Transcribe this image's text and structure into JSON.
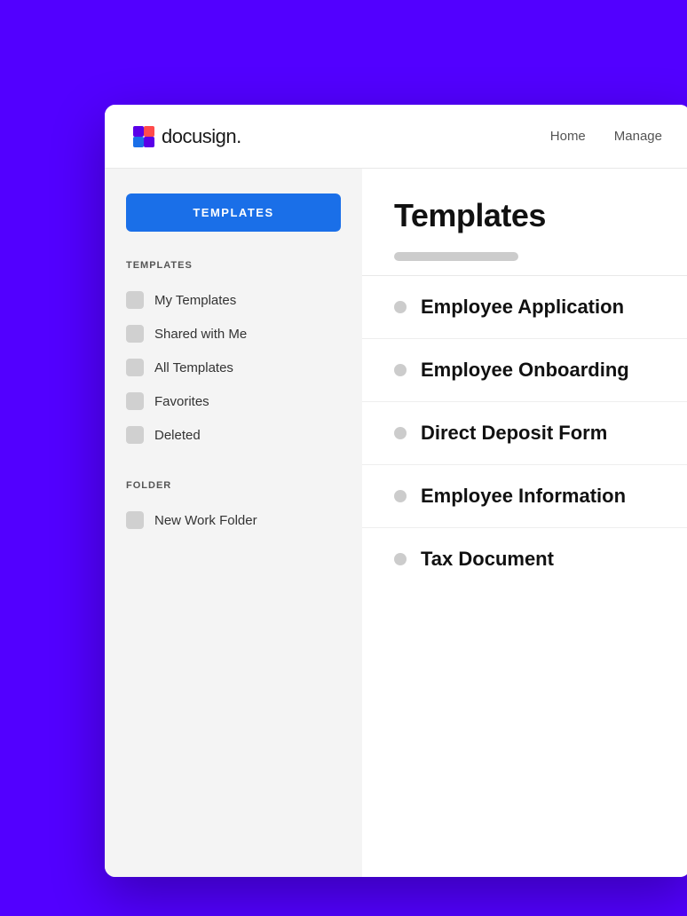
{
  "header": {
    "logo_text": "docusign.",
    "nav": {
      "home": "Home",
      "manage": "Manage"
    }
  },
  "sidebar": {
    "templates_button_label": "TEMPLATES",
    "templates_section_title": "TEMPLATES",
    "template_items": [
      {
        "label": "My Templates"
      },
      {
        "label": "Shared with Me"
      },
      {
        "label": "All Templates"
      },
      {
        "label": "Favorites"
      },
      {
        "label": "Deleted"
      }
    ],
    "folder_section_title": "FOLDER",
    "folder_items": [
      {
        "label": "New Work Folder"
      }
    ]
  },
  "content": {
    "page_title": "Templates",
    "template_list": [
      {
        "name": "Employee Application"
      },
      {
        "name": "Employee Onboarding"
      },
      {
        "name": "Direct Deposit Form"
      },
      {
        "name": "Employee Information"
      },
      {
        "name": "Tax Document"
      }
    ]
  }
}
